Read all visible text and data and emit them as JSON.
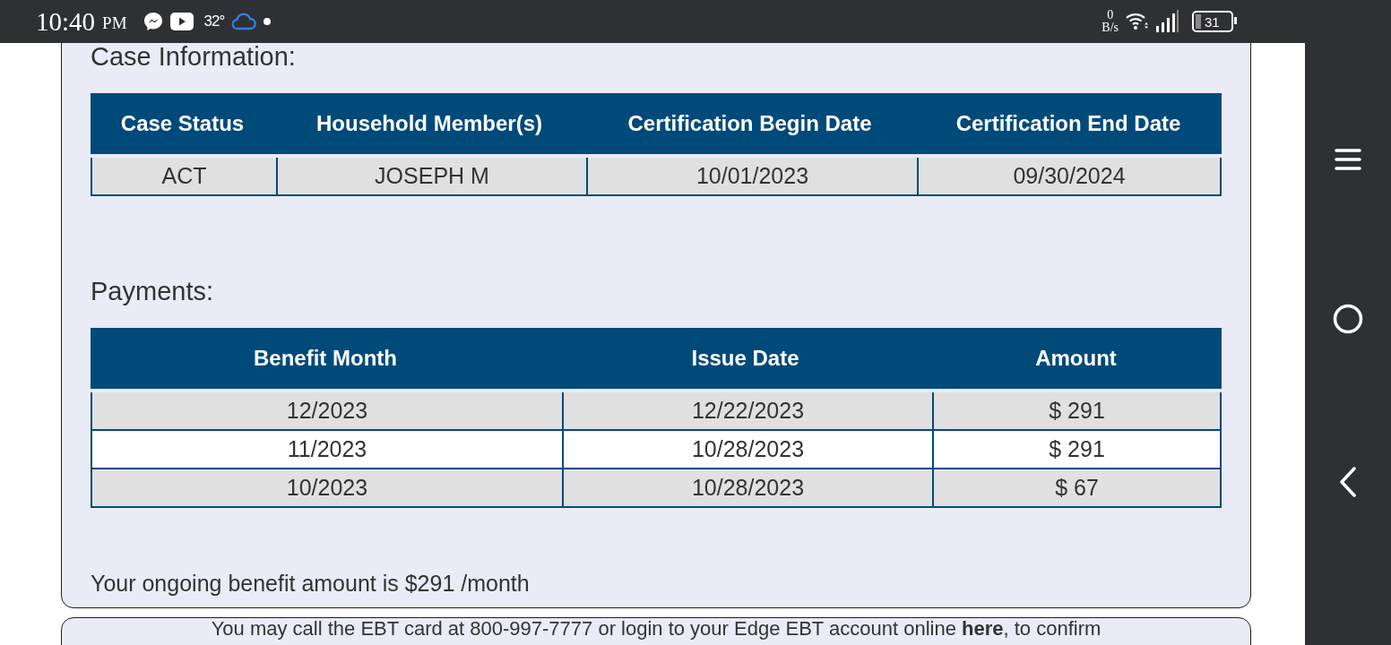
{
  "status_bar": {
    "time": "10:40",
    "meridiem": "PM",
    "temperature": "32°",
    "net_speed_value": "0",
    "net_speed_unit": "B/s",
    "battery": "31"
  },
  "case_information": {
    "title": "Case Information:",
    "columns": [
      "Case Status",
      "Household Member(s)",
      "Certification Begin Date",
      "Certification End Date"
    ],
    "rows": [
      [
        "ACT",
        "JOSEPH M",
        "10/01/2023",
        "09/30/2024"
      ]
    ]
  },
  "payments": {
    "title": "Payments:",
    "columns": [
      "Benefit Month",
      "Issue Date",
      "Amount"
    ],
    "rows": [
      [
        "12/2023",
        "12/22/2023",
        "$ 291"
      ],
      [
        "11/2023",
        "10/28/2023",
        "$ 291"
      ],
      [
        "10/2023",
        "10/28/2023",
        "$ 67"
      ]
    ]
  },
  "ongoing_note": "Your ongoing benefit amount is $291 /month",
  "next_card_text": "You may call the EBT card at 800-997-7777 or login to your Edge EBT account online **here**, to confirm"
}
